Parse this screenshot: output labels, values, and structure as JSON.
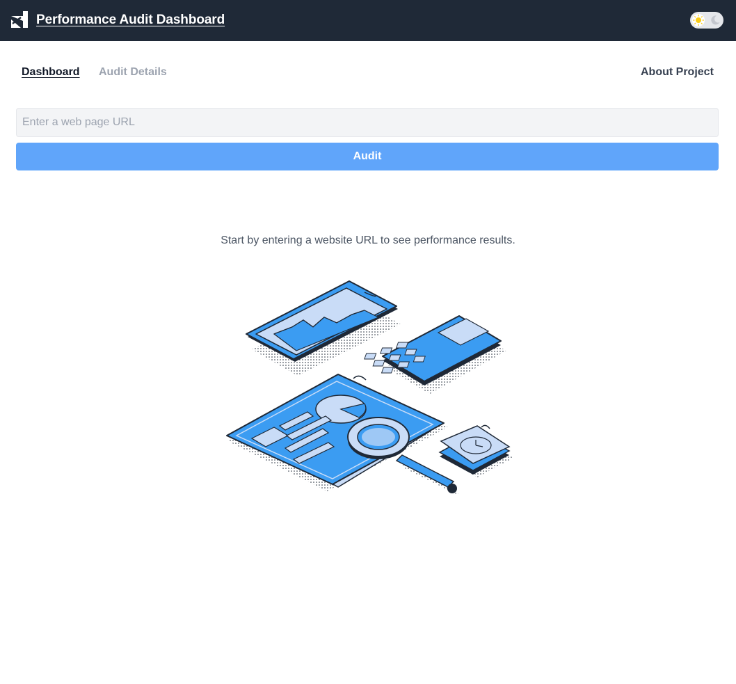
{
  "header": {
    "title": "Performance Audit Dashboard",
    "logo_icon": "arrow-up-right-logo-icon",
    "theme_toggle": {
      "light_icon": "sun-icon",
      "dark_icon": "moon-icon",
      "mode": "light"
    }
  },
  "nav": {
    "dashboard": "Dashboard",
    "audit_details": "Audit Details",
    "about": "About Project"
  },
  "audit_form": {
    "placeholder": "Enter a web page URL",
    "value": "",
    "button_label": "Audit"
  },
  "empty_state": {
    "message": "Start by entering a website URL to see performance results.",
    "illustration": "analytics-report-illustration"
  },
  "colors": {
    "header_bg": "#1f2937",
    "accent": "#60a5fa",
    "illustration_blue": "#3b9cf2",
    "illustration_light": "#c9dcf7"
  }
}
